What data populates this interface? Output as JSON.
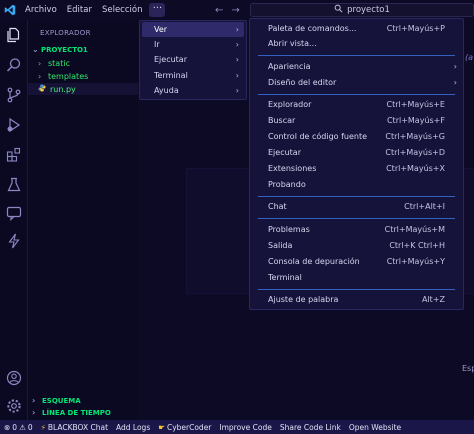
{
  "titlebar": {
    "menu": [
      "Archivo",
      "Editar",
      "Selección"
    ],
    "more": "···",
    "search": "proyecto1"
  },
  "sidebar": {
    "title": "EXPLORADOR",
    "project": "PROYECTO1",
    "items": [
      {
        "label": "static"
      },
      {
        "label": "templates"
      },
      {
        "label": "run.py"
      }
    ],
    "esquema": "ESQUEMA",
    "timeline": "LÍNEA DE TIEMPO"
  },
  "menu1": {
    "items": [
      "Ver",
      "Ir",
      "Ejecutar",
      "Terminal",
      "Ayuda"
    ]
  },
  "menu2": {
    "items": [
      {
        "label": "Paleta de comandos...",
        "key": "Ctrl+Mayús+P"
      },
      {
        "label": "Abrir vista...",
        "key": ""
      },
      {
        "label": "Apariencia",
        "key": ""
      },
      {
        "label": "Diseño del editor",
        "key": ""
      },
      {
        "label": "Explorador",
        "key": "Ctrl+Mayús+E"
      },
      {
        "label": "Buscar",
        "key": "Ctrl+Mayús+F"
      },
      {
        "label": "Control de código fuente",
        "key": "Ctrl+Mayús+G"
      },
      {
        "label": "Ejecutar",
        "key": "Ctrl+Mayús+D"
      },
      {
        "label": "Extensiones",
        "key": "Ctrl+Mayús+X"
      },
      {
        "label": "Probando",
        "key": ""
      },
      {
        "label": "Chat",
        "key": "Ctrl+Alt+I"
      },
      {
        "label": "Problemas",
        "key": "Ctrl+Mayús+M"
      },
      {
        "label": "Salida",
        "key": "Ctrl+K Ctrl+H"
      },
      {
        "label": "Consola de depuración",
        "key": "Ctrl+Mayús+Y"
      },
      {
        "label": "Terminal",
        "key": ""
      },
      {
        "label": "Ajuste de palabra",
        "key": "Alt+Z"
      }
    ]
  },
  "fragments": {
    "right_top": "(a",
    "right_bottom": "Esp"
  },
  "statusbar": {
    "problems": "0",
    "warnings": "0",
    "items": [
      "BLACKBOX Chat",
      "Add Logs",
      "CyberCoder",
      "Improve Code",
      "Share Code Link",
      "Open Website"
    ]
  }
}
